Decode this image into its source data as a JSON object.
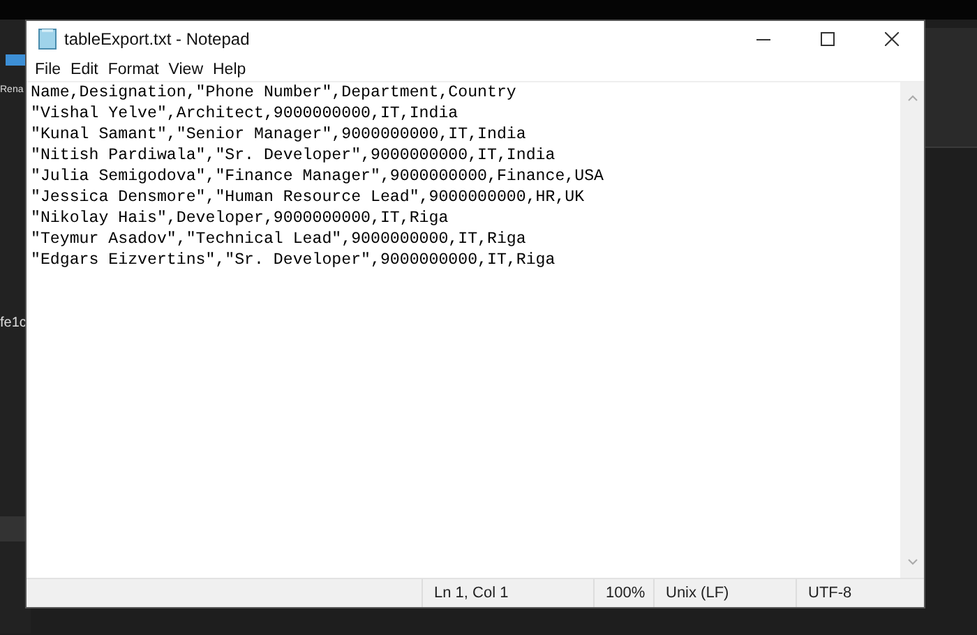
{
  "background_app": {
    "texts": [
      "Rena",
      "fe1c"
    ]
  },
  "window": {
    "title": "tableExport.txt - Notepad"
  },
  "menu": [
    "File",
    "Edit",
    "Format",
    "View",
    "Help"
  ],
  "editor": {
    "lines": [
      "Name,Designation,\"Phone Number\",Department,Country",
      "\"Vishal Yelve\",Architect,9000000000,IT,India",
      "\"Kunal Samant\",\"Senior Manager\",9000000000,IT,India",
      "\"Nitish Pardiwala\",\"Sr. Developer\",9000000000,IT,India",
      "\"Julia Semigodova\",\"Finance Manager\",9000000000,Finance,USA",
      "\"Jessica Densmore\",\"Human Resource Lead\",9000000000,HR,UK",
      "\"Nikolay Hais\",Developer,9000000000,IT,Riga",
      "\"Teymur Asadov\",\"Technical Lead\",9000000000,IT,Riga",
      "\"Edgars Eizvertins\",\"Sr. Developer\",9000000000,IT,Riga"
    ]
  },
  "status_bar": [
    "Ln 1, Col 1",
    "100%",
    "Unix (LF)",
    "UTF-8"
  ]
}
